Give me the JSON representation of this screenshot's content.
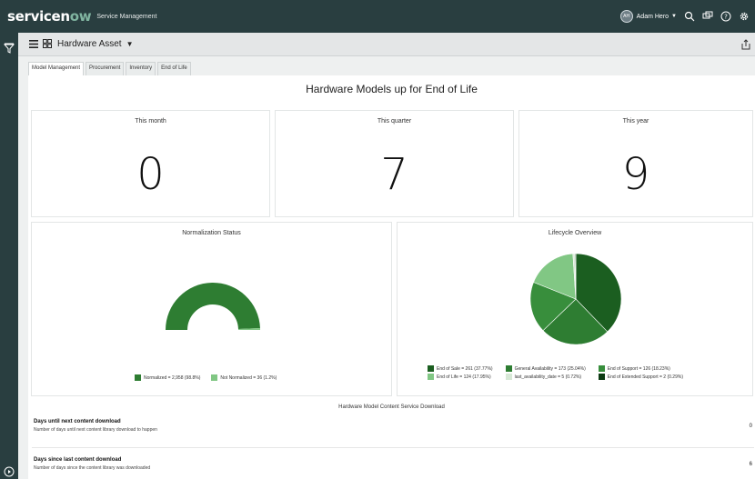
{
  "banner": {
    "brand_main": "servicen",
    "brand_ow": "ow",
    "app_name": "Service Management",
    "user_initials": "AH",
    "user_name": "Adam Hero"
  },
  "titlebar": {
    "dashboard_name": "Hardware Asset"
  },
  "tabs": [
    {
      "label": "Model Management",
      "active": true
    },
    {
      "label": "Procurement",
      "active": false
    },
    {
      "label": "Inventory",
      "active": false
    },
    {
      "label": "End of Life",
      "active": false
    }
  ],
  "page_title": "Hardware Models up for End of Life",
  "counters": [
    {
      "label": "This month",
      "value": "0"
    },
    {
      "label": "This quarter",
      "value": "7"
    },
    {
      "label": "This year",
      "value": "9"
    }
  ],
  "normalization": {
    "title": "Normalization Status",
    "legend": [
      {
        "label": "Normalized = 2,958 (98.8%)",
        "color": "#2e7d32"
      },
      {
        "label": "Not Normalized = 36 (1.2%)",
        "color": "#81c784"
      }
    ]
  },
  "lifecycle": {
    "title": "Lifecycle Overview",
    "legend": [
      {
        "label": "End of Sale = 261 (37.77%)",
        "color": "#1b5e20"
      },
      {
        "label": "End of Life = 124 (17.95%)",
        "color": "#81c784"
      },
      {
        "label": "General Availability = 173 (25.04%)",
        "color": "#2e7d32"
      },
      {
        "label": "last_availability_date = 5 (0.72%)",
        "color": "#d7e8d6"
      },
      {
        "label": "End of Support = 126 (18.23%)",
        "color": "#388e3c"
      },
      {
        "label": "End of Extended Support = 2 (0.29%)",
        "color": "#0d3b13"
      }
    ]
  },
  "chart_data": [
    {
      "type": "pie",
      "title": "Normalization Status",
      "categories": [
        "Normalized",
        "Not Normalized"
      ],
      "values": [
        2958,
        36
      ]
    },
    {
      "type": "pie",
      "title": "Lifecycle Overview",
      "categories": [
        "End of Sale",
        "General Availability",
        "End of Support",
        "End of Life",
        "last_availability_date",
        "End of Extended Support"
      ],
      "values": [
        261,
        173,
        126,
        124,
        5,
        2
      ]
    }
  ],
  "download": {
    "title": "Hardware Model Content Service Download",
    "rows": [
      {
        "label": "Days until next content download",
        "desc": "Number of days until next content library download to happen",
        "value": "0"
      },
      {
        "label": "Days since last content download",
        "desc": "Number of days since the content library was downloaded",
        "value": "6"
      }
    ]
  }
}
